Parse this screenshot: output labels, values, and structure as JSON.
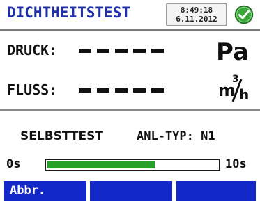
{
  "header": {
    "title": "DICHTHEITSTEST",
    "clock_time": "8:49:18",
    "clock_date": "6.11.2012",
    "status_icon": "check-circle-icon",
    "status_color": "#3aa63a"
  },
  "readings": {
    "pressure_label": "DRUCK:",
    "pressure_value": "-----",
    "pressure_unit": "Pa",
    "flow_label": "FLUSS:",
    "flow_value": "-----",
    "flow_unit_num": "m",
    "flow_unit_exp": "3",
    "flow_unit_den": "h"
  },
  "status": {
    "mode": "SELBSTTEST",
    "anlage_type": "ANL-TYP: N1"
  },
  "progress": {
    "start_label": "0s",
    "end_label": "10s",
    "fraction": 0.63,
    "fill_color": "#26a026"
  },
  "softkeys": [
    {
      "label": "Abbr."
    },
    {
      "label": ""
    },
    {
      "label": ""
    }
  ],
  "colors": {
    "title": "#1f2fa8",
    "softkey_bg": "#1228c8"
  }
}
